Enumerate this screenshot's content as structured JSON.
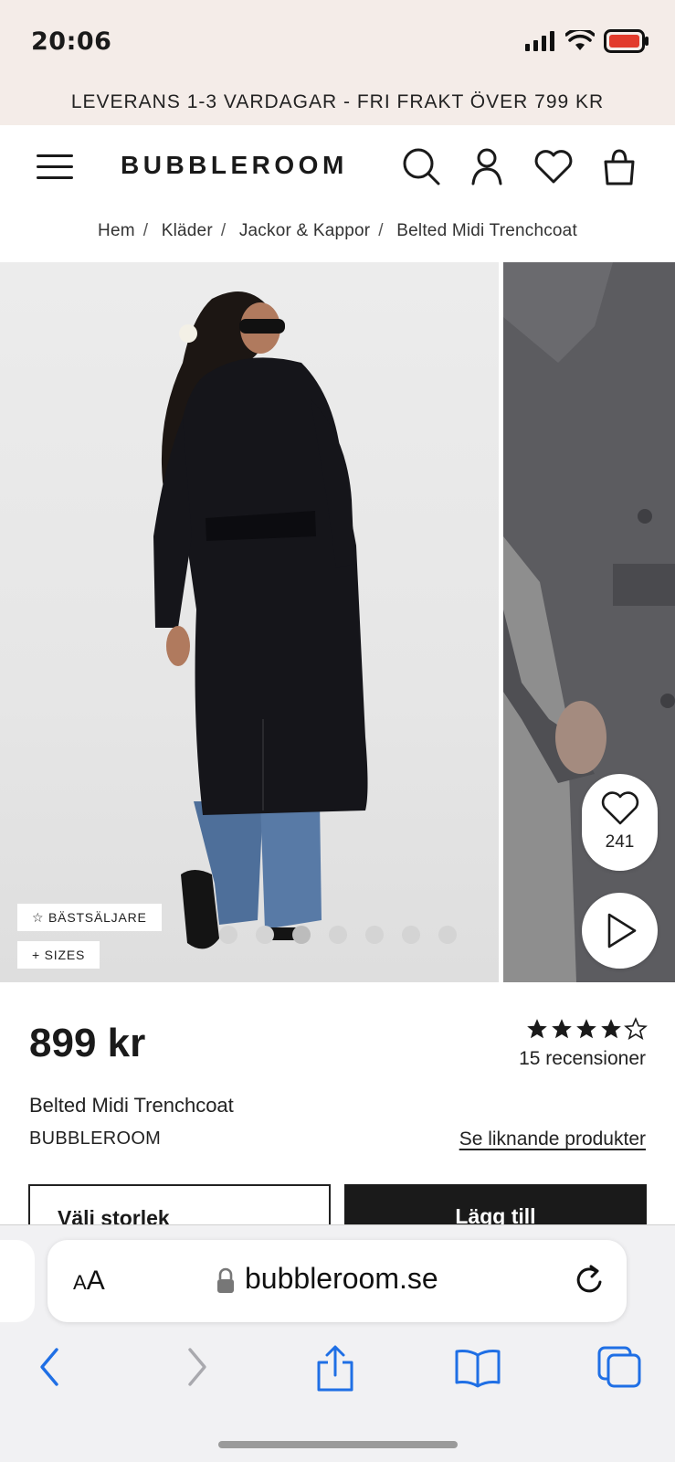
{
  "status_bar": {
    "time": "20:06"
  },
  "announcement": "LEVERANS 1-3 VARDAGAR - FRI FRAKT ÖVER 799 KR",
  "header": {
    "logo": "BUBBLEROOM"
  },
  "breadcrumb": [
    "Hem",
    "Kläder",
    "Jackor & Kappor",
    "Belted Midi Trenchcoat"
  ],
  "gallery": {
    "tags": [
      "BÄSTSÄLJARE",
      "SIZES"
    ],
    "favorites_count": "241",
    "dot_count": 7,
    "active_dot": 2
  },
  "product": {
    "price": "899 kr",
    "rating": 4,
    "rating_max": 5,
    "reviews": "15 recensioner",
    "name": "Belted Midi Trenchcoat",
    "brand": "BUBBLEROOM",
    "similar_link": "Se liknande produkter",
    "size_button": "Välj storlek",
    "add_button": "Lägg till"
  },
  "browser": {
    "text_size": "AA",
    "url": "bubbleroom.se"
  }
}
